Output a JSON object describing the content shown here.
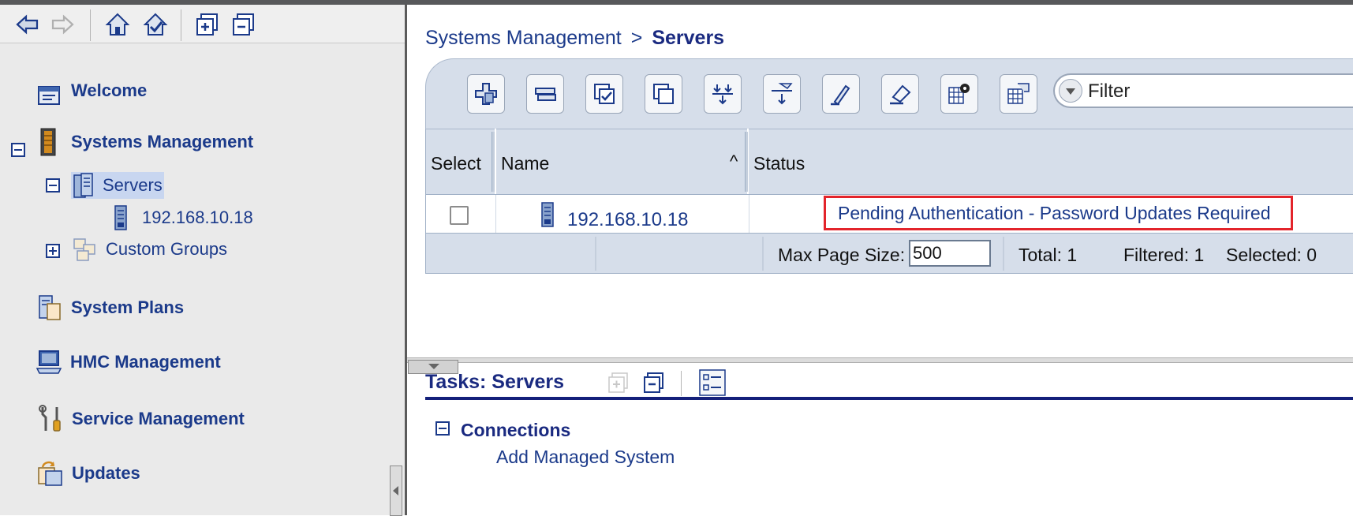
{
  "navigation": {
    "toolbar_icons": [
      "back-icon",
      "forward-icon",
      "home-icon",
      "home-check-icon",
      "expand-all-icon",
      "collapse-all-icon"
    ],
    "items": [
      {
        "label": "Welcome",
        "icon": "welcome-icon"
      },
      {
        "label": "Systems Management",
        "icon": "systems-management-icon",
        "expanded": true
      },
      {
        "label": "Servers",
        "icon": "servers-icon",
        "expanded": true,
        "selected": true
      },
      {
        "label": "192.168.10.18",
        "icon": "server-icon"
      },
      {
        "label": "Custom Groups",
        "icon": "custom-groups-icon",
        "expanded": false
      },
      {
        "label": "System Plans",
        "icon": "system-plans-icon"
      },
      {
        "label": "HMC Management",
        "icon": "hmc-management-icon"
      },
      {
        "label": "Service Management",
        "icon": "service-management-icon"
      },
      {
        "label": "Updates",
        "icon": "updates-icon"
      }
    ]
  },
  "breadcrumb": {
    "parent": "Systems Management",
    "separator": ">",
    "current": "Servers"
  },
  "table": {
    "toolbar_icons": [
      "add-system-icon",
      "manage-icon",
      "select-all-icon",
      "deselect-all-icon",
      "expand-rows-icon",
      "filter-rows-icon",
      "edit-sort-icon",
      "clear-sort-icon",
      "configure-columns-icon",
      "view-icon"
    ],
    "filter_placeholder": "Filter",
    "columns": [
      "Select",
      "Name",
      "Status"
    ],
    "sort_indicator": "^",
    "rows": [
      {
        "selected": false,
        "name": "192.168.10.18",
        "status": "Pending Authentication - Password Updates Required"
      }
    ],
    "footer": {
      "max_page_size_label": "Max Page Size:",
      "max_page_size_value": "500",
      "total": "Total: 1",
      "filtered": "Filtered: 1",
      "selected": "Selected: 0"
    }
  },
  "tasks": {
    "title": "Tasks: Servers",
    "section": "Connections",
    "links": [
      "Add Managed System"
    ]
  },
  "colors": {
    "link": "#1b3a8a",
    "title": "#1a2a80",
    "highlight_border": "#e3242b",
    "table_header_bg": "#d6deea"
  }
}
